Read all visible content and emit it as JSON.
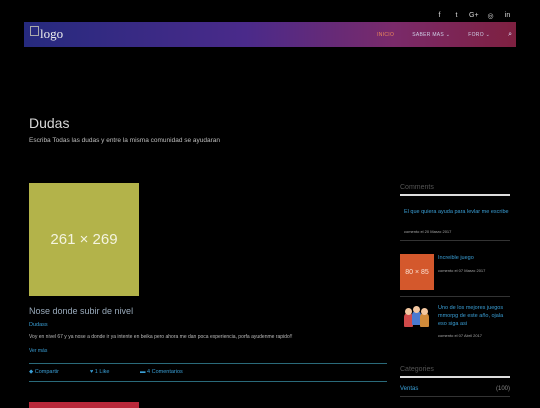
{
  "social": [
    "f",
    "t",
    "G+",
    "◎",
    "in"
  ],
  "nav": {
    "logo_alt": "logo",
    "items": [
      {
        "label": "INICIO"
      },
      {
        "label": "SABER MAS ⌄"
      },
      {
        "label": "FORO ⌄"
      }
    ],
    "search_icon": "search-icon"
  },
  "hero": {
    "title": "Dudas",
    "subtitle": "Escriba Todas las dudas y entre la misma comunidad se ayudaran"
  },
  "post": {
    "thumb_label": "261 × 269",
    "title": "Nose donde subir de nivel",
    "category": "Dudass",
    "excerpt": "Voy en nivel 67 y ya nose a donde ir ya intente en beika pero ahora me dan poca experiencia, porfa ayudenme rapido!!",
    "more": "Ver más",
    "share": "Compartir",
    "likes": "1 Like",
    "comments": "4 Comentarios"
  },
  "sidebar": {
    "comments_heading": "Comments",
    "comments": [
      {
        "text": "El que quiera ayuda para levlar me escribe",
        "meta": "comento el 20 Marzo 2017"
      },
      {
        "text": "Increible juego",
        "meta": "comento el 07 Marzo 2017",
        "thumb": "80 × 85"
      },
      {
        "text": "Uno de los mejores juegos mmorpg de este año, ojala eso siga asi",
        "meta": "comento el 07 Abril 2017"
      }
    ],
    "categories_heading": "Categories",
    "categories": [
      {
        "name": "Ventas",
        "count": "(100)"
      }
    ]
  },
  "colors": {
    "accent": "#3a9fd6",
    "nav_start": "#262a7e",
    "nav_end": "#7e2040"
  }
}
